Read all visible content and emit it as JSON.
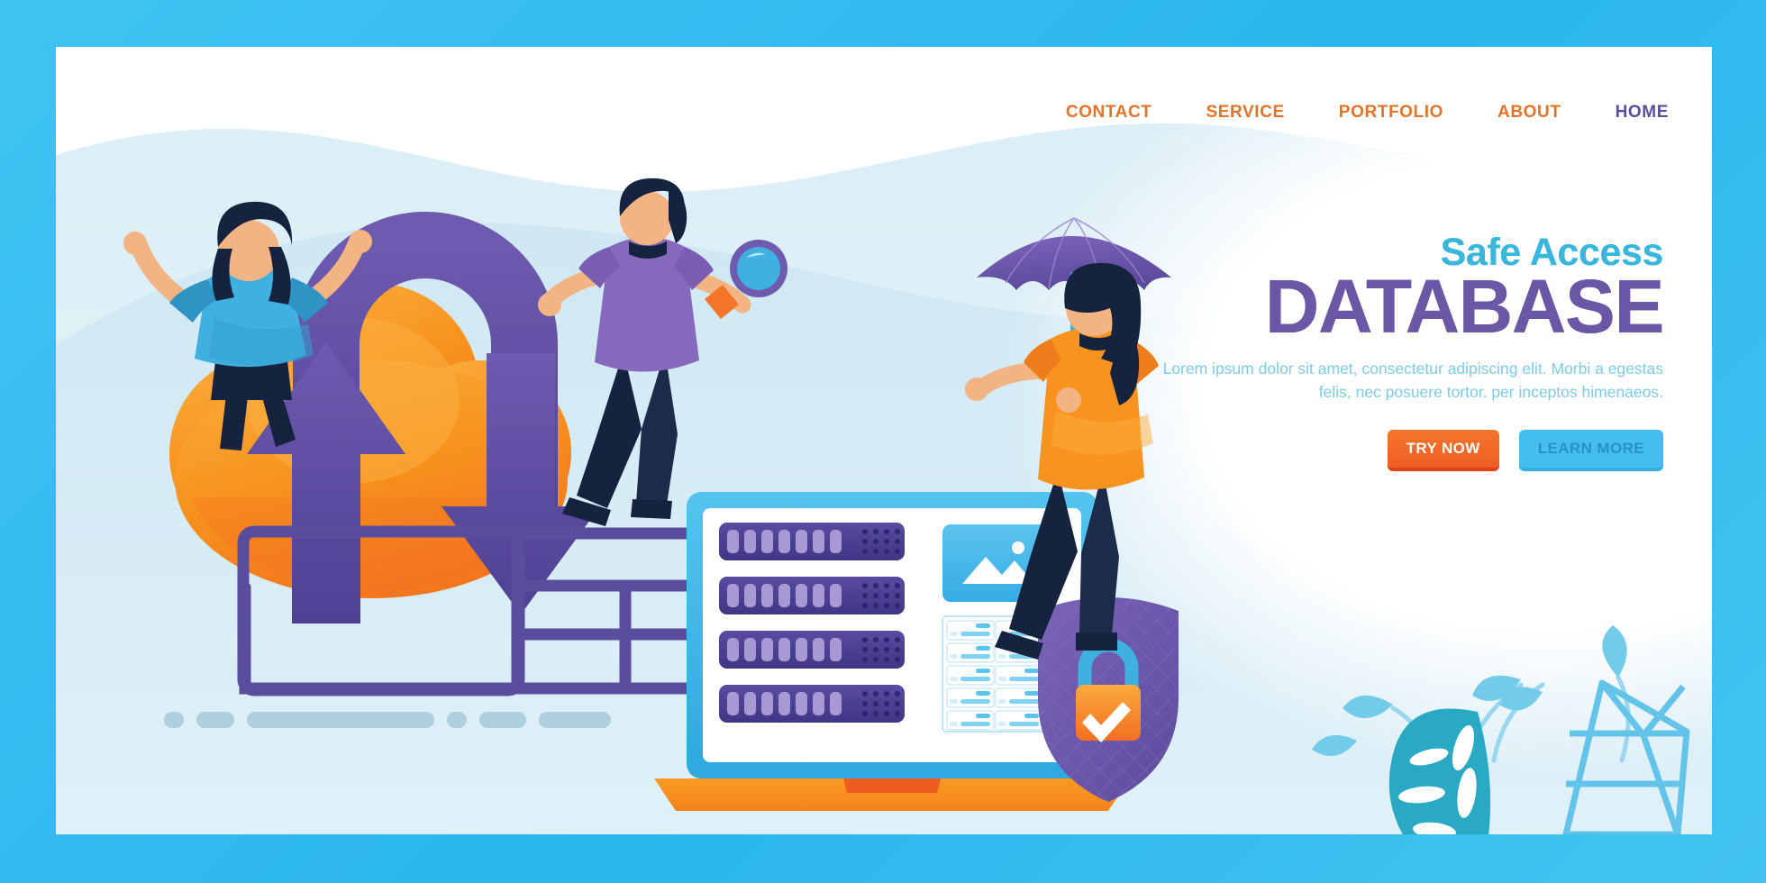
{
  "page": {
    "frame_color": "#35bdf0",
    "card_background": "#ffffff"
  },
  "nav": {
    "items": [
      {
        "label": "CONTACT",
        "active": false,
        "color": "#e2742a"
      },
      {
        "label": "SERVICE",
        "active": false,
        "color": "#e2742a"
      },
      {
        "label": "PORTFOLIO",
        "active": false,
        "color": "#e2742a"
      },
      {
        "label": "ABOUT",
        "active": false,
        "color": "#e2742a"
      },
      {
        "label": "HOME",
        "active": true,
        "color": "#5b4d9e"
      }
    ]
  },
  "hero": {
    "eyebrow": "Safe Access",
    "title": "DATABASE",
    "body": "Lorem ipsum dolor sit amet, consectetur adipiscing elit. Morbi a egestas felis, nec posuere tortor. per inceptos himenaeos.",
    "eyebrow_color": "#3ab5dc",
    "title_color": "#6a57a6",
    "body_color": "#7ecbe8",
    "primary_cta": "TRY NOW",
    "secondary_cta": "LEARN MORE",
    "primary_cta_color": "#ef5c22",
    "secondary_cta_color": "#45bdee"
  },
  "illustration": {
    "theme": "cloud database security",
    "cloud_color": "#f79320",
    "arrow_color": "#5b4d9e",
    "server_rack_color": "#4a3f92",
    "shield_color": "#6e5aae",
    "padlock_color": "#f58220",
    "umbrella_color": "#6b54a8",
    "laptop_base_color": "#f7931e",
    "laptop_frame_color": "#3cb4e5",
    "characters": [
      {
        "name": "woman-cheering",
        "shirt": "#3fb0e0",
        "pants": "#16233f"
      },
      {
        "name": "man-with-magnifier",
        "shirt": "#8668bd",
        "pants": "#16233f"
      },
      {
        "name": "woman-with-umbrella",
        "shirt": "#f7931e",
        "pants": "#16233f"
      }
    ],
    "laptop_screen": {
      "server_rack_count": 4,
      "image_placeholder": "image-placeholder-icon",
      "table_rows": 5,
      "table_columns": 2
    },
    "plant": {
      "leaf_color": "#2aa9c4",
      "pot_color": "#63c3e8"
    }
  },
  "skeleton_bars": {
    "widths": [
      22,
      42,
      208,
      22,
      52,
      80
    ]
  }
}
